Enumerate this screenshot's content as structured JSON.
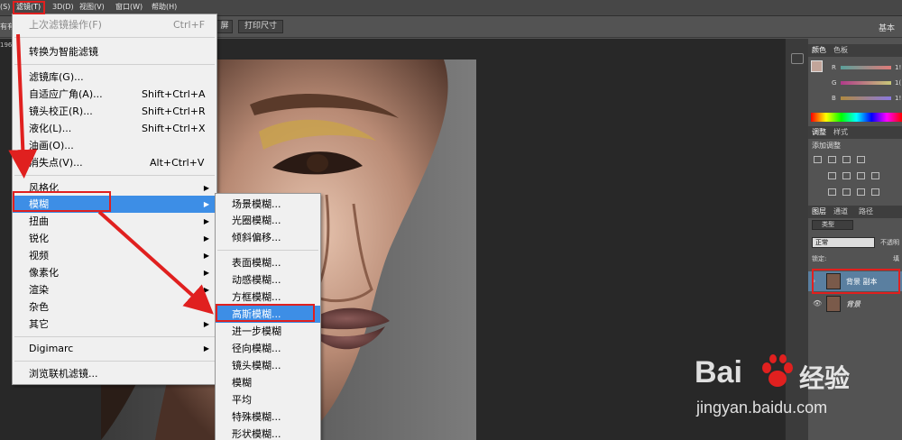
{
  "menubar": {
    "items": [
      {
        "label": "(S)"
      },
      {
        "label": "滤镜(T)"
      },
      {
        "label": "3D(D)"
      },
      {
        "label": "视图(V)"
      },
      {
        "label": "窗口(W)"
      },
      {
        "label": "帮助(H)"
      }
    ]
  },
  "optbar": {
    "left_fragment": "有有",
    "btn_partial": "屏",
    "print_size": "打印尺寸",
    "right_fragment": "基本"
  },
  "doc": {
    "tab_fragment": "196"
  },
  "filter_menu": {
    "items": [
      {
        "label": "上次滤镜操作(F)",
        "shortcut": "Ctrl+F",
        "disabled": true
      },
      {
        "label": "转换为智能滤镜"
      },
      {
        "label": "滤镜库(G)..."
      },
      {
        "label": "自适应广角(A)...",
        "shortcut": "Shift+Ctrl+A"
      },
      {
        "label": "镜头校正(R)...",
        "shortcut": "Shift+Ctrl+R"
      },
      {
        "label": "液化(L)...",
        "shortcut": "Shift+Ctrl+X"
      },
      {
        "label": "油画(O)..."
      },
      {
        "label": "消失点(V)...",
        "shortcut": "Alt+Ctrl+V"
      },
      {
        "label": "风格化",
        "submenu": true
      },
      {
        "label": "模糊",
        "submenu": true,
        "highlighted": true
      },
      {
        "label": "扭曲",
        "submenu": true
      },
      {
        "label": "锐化",
        "submenu": true
      },
      {
        "label": "视频",
        "submenu": true
      },
      {
        "label": "像素化",
        "submenu": true
      },
      {
        "label": "渲染",
        "submenu": true
      },
      {
        "label": "杂色",
        "submenu": true
      },
      {
        "label": "其它",
        "submenu": true
      },
      {
        "label": "Digimarc",
        "submenu": true
      },
      {
        "label": "浏览联机滤镜..."
      }
    ]
  },
  "blur_menu": {
    "items": [
      {
        "label": "场景模糊..."
      },
      {
        "label": "光圈模糊..."
      },
      {
        "label": "倾斜偏移..."
      },
      {
        "label": "表面模糊..."
      },
      {
        "label": "动感模糊..."
      },
      {
        "label": "方框模糊..."
      },
      {
        "label": "高斯模糊...",
        "highlighted": true
      },
      {
        "label": "进一步模糊"
      },
      {
        "label": "径向模糊..."
      },
      {
        "label": "镜头模糊..."
      },
      {
        "label": "模糊"
      },
      {
        "label": "平均"
      },
      {
        "label": "特殊模糊..."
      },
      {
        "label": "形状模糊..."
      }
    ]
  },
  "panels": {
    "color_tabs": [
      "颜色",
      "色板"
    ],
    "sliders": [
      {
        "label": "R",
        "value": "1!"
      },
      {
        "label": "G",
        "value": "1("
      },
      {
        "label": "B",
        "value": "1!"
      }
    ],
    "adjust_tabs": [
      "调整",
      "样式"
    ],
    "adjust_title": "添加调整",
    "layer_tabs": [
      "图层",
      "通道",
      "路径"
    ],
    "filter_kind": "类型",
    "blend_mode": "正常",
    "opacity_label": "不透明",
    "lock_label": "锁定:",
    "fill_label": "填",
    "layers": [
      {
        "name": "背景 副本",
        "selected": true
      },
      {
        "name": "背景",
        "selected": false
      }
    ]
  },
  "watermark": {
    "brand": "Bai",
    "brand_after": "经验",
    "url": "jingyan.baidu.com"
  },
  "colors": {
    "highlight": "#3d8ee6",
    "annotation_red": "#e0201f"
  }
}
